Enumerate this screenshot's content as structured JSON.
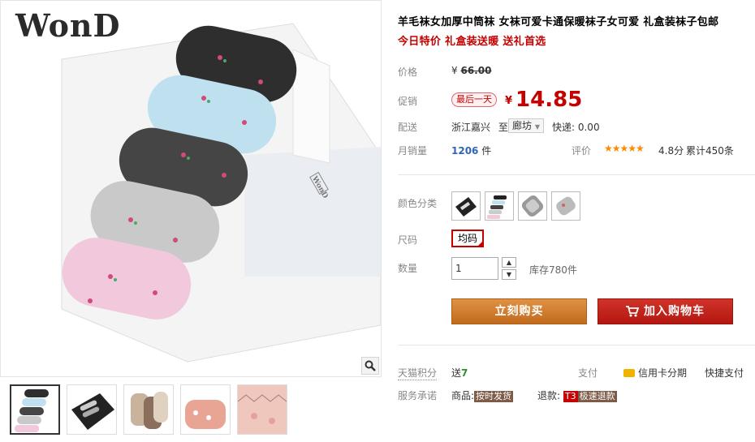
{
  "gallery": {
    "logo_text": "WonD",
    "thumbnails": [
      "thumb-1",
      "thumb-2",
      "thumb-3",
      "thumb-4",
      "thumb-5"
    ]
  },
  "product": {
    "title": "羊毛袜女加厚中筒袜 女袜可爱卡通保暖袜子女可爱 礼盒装袜子包邮",
    "subtitle": "今日特价 礼盒装送暖 送礼首选"
  },
  "price": {
    "label": "价格",
    "currency": "¥",
    "original": "66.00"
  },
  "promo": {
    "label": "促销",
    "tag": "最后一天",
    "currency": "¥",
    "price": "14.85"
  },
  "shipping": {
    "label": "配送",
    "from": "浙江嘉兴",
    "to_word": "至",
    "to": "廊坊",
    "fee": "快递: 0.00"
  },
  "sales": {
    "label": "月销量",
    "count": "1206",
    "unit": "件",
    "rating_label": "评价",
    "stars": "★★★★★",
    "score": "4.8分",
    "reviews": "累计450条"
  },
  "options": {
    "color_label": "颜色分类",
    "size_label": "尺码",
    "size_value": "均码",
    "qty_label": "数量",
    "qty_value": "1",
    "stock": "库存780件"
  },
  "actions": {
    "buy_now": "立刻购买",
    "add_cart": "加入购物车"
  },
  "extras": {
    "points_label": "天猫积分",
    "points_prefix": "送",
    "points_value": "7",
    "pay_label": "支付",
    "credit": "信用卡分期",
    "quickpay": "快捷支付",
    "service_label": "服务承诺",
    "svc1_prefix": "商品:",
    "svc1_tag": "按时发货",
    "svc2_prefix": "退款:",
    "svc2_badge": "T3",
    "svc2_tag": "极速退款"
  },
  "colors": {
    "accent_red": "#c40000",
    "buy_orange": "#d07f30",
    "cart_red": "#c4241b",
    "link_blue": "#3066b5"
  }
}
